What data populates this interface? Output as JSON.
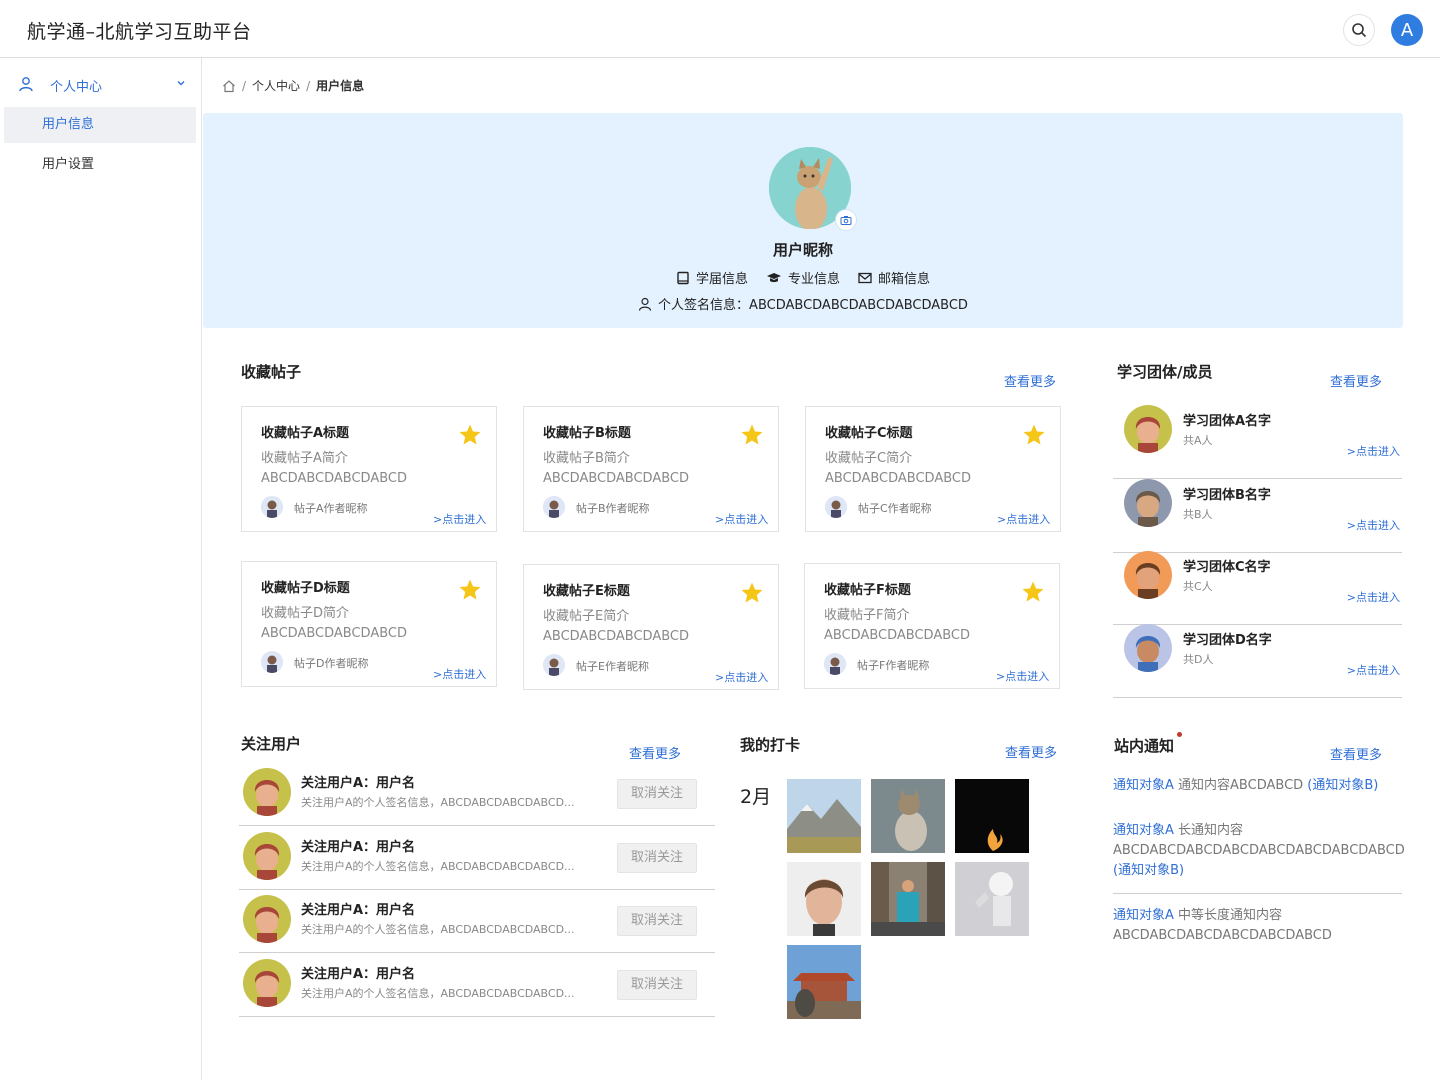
{
  "app": {
    "title": "航学通–北航学习互助平台",
    "user_initial": "A"
  },
  "sidebar": {
    "group_label": "个人中心",
    "items": [
      {
        "label": "用户信息"
      },
      {
        "label": "用户设置"
      }
    ]
  },
  "breadcrumb": {
    "items": [
      "个人中心",
      "用户信息"
    ]
  },
  "profile": {
    "nickname": "用户昵称",
    "grade": "学届信息",
    "major": "专业信息",
    "email": "邮箱信息",
    "signature": "个人签名信息：ABCDABCDABCDABCDABCDABCD"
  },
  "favorites": {
    "title": "收藏帖子",
    "more": "查看更多",
    "go": ">点击进入",
    "posts": [
      {
        "title": "收藏帖子A标题",
        "desc1": "收藏帖子A简介",
        "desc2": "ABCDABCDABCDABCD",
        "author": "帖子A作者昵称"
      },
      {
        "title": "收藏帖子B标题",
        "desc1": "收藏帖子B简介",
        "desc2": "ABCDABCDABCDABCD",
        "author": "帖子B作者昵称"
      },
      {
        "title": "收藏帖子C标题",
        "desc1": "收藏帖子C简介",
        "desc2": "ABCDABCDABCDABCD",
        "author": "帖子C作者昵称"
      },
      {
        "title": "收藏帖子D标题",
        "desc1": "收藏帖子D简介",
        "desc2": "ABCDABCDABCDABCD",
        "author": "帖子D作者昵称"
      },
      {
        "title": "收藏帖子E标题",
        "desc1": "收藏帖子E简介",
        "desc2": "ABCDABCDABCDABCD",
        "author": "帖子E作者昵称"
      },
      {
        "title": "收藏帖子F标题",
        "desc1": "收藏帖子F简介",
        "desc2": "ABCDABCDABCDABCD",
        "author": "帖子F作者昵称"
      }
    ]
  },
  "groups": {
    "title": "学习团体/成员",
    "more": "查看更多",
    "go": ">点击进入",
    "items": [
      {
        "name": "学习团体A名字",
        "count": "共A人"
      },
      {
        "name": "学习团体B名字",
        "count": "共B人"
      },
      {
        "name": "学习团体C名字",
        "count": "共C人"
      },
      {
        "name": "学习团体D名字",
        "count": "共D人"
      }
    ]
  },
  "follows": {
    "title": "关注用户",
    "more": "查看更多",
    "unfollow": "取消关注",
    "items": [
      {
        "name": "关注用户A：用户名",
        "sign": "关注用户A的个人签名信息，ABCDABCDABCDABCD..."
      },
      {
        "name": "关注用户A：用户名",
        "sign": "关注用户A的个人签名信息，ABCDABCDABCDABCD..."
      },
      {
        "name": "关注用户A：用户名",
        "sign": "关注用户A的个人签名信息，ABCDABCDABCDABCD..."
      },
      {
        "name": "关注用户A：用户名",
        "sign": "关注用户A的个人签名信息，ABCDABCDABCDABCD..."
      }
    ]
  },
  "checkin": {
    "title": "我的打卡",
    "more": "查看更多",
    "month": "2月"
  },
  "notices": {
    "title": "站内通知",
    "more": "查看更多",
    "items": [
      {
        "a": "通知对象A",
        "text": " 通知内容ABCDABCD ",
        "b": "(通知对象B)"
      },
      {
        "a": "通知对象A",
        "text": " 长通知内容ABCDABCDABCDABCDABCDABCDABCDABCD ",
        "b": "(通知对象B)"
      },
      {
        "a": "通知对象A",
        "text": " 中等长度通知内容ABCDABCDABCDABCDABCDABCD",
        "b": ""
      }
    ]
  },
  "colors": {
    "accent": "#2f6fd6",
    "profile_bg": "#e4f1fe",
    "star": "#f5c518",
    "avatar_bg": "#2f7de1"
  }
}
